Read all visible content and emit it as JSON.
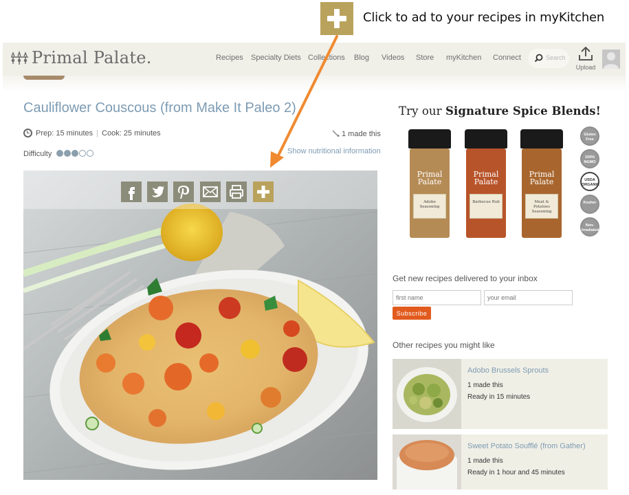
{
  "callout": {
    "text": "Click to ad to your recipes in myKitchen",
    "icon": "plus-icon",
    "color": "#b9a25b"
  },
  "navbar": {
    "logo": "Primal Palate.",
    "items": [
      "Recipes",
      "Specialty Diets",
      "Collections",
      "Blog",
      "Videos",
      "Store",
      "myKitchen",
      "Connect"
    ],
    "search_placeholder": "Search",
    "upload_label": "Upload"
  },
  "recipe": {
    "title": "Cauliflower Couscous (from Make It Paleo 2)",
    "prep": "Prep: 15 minutes",
    "cook": "Cook: 25 minutes",
    "made_this": "1 made this",
    "difficulty_label": "Difficulty",
    "difficulty_level": 3,
    "difficulty_max": 5,
    "nutrition_link": "Show nutritional information",
    "share_buttons": [
      "facebook-icon",
      "twitter-icon",
      "pinterest-icon",
      "email-icon",
      "print-icon",
      "plus-icon"
    ]
  },
  "sidebar": {
    "spice_title_pre": "Try our",
    "spice_title_bold": "Signature Spice Blends!",
    "jar_brand": "Primal Palate",
    "jars": [
      {
        "name": "Adobo Seasoning",
        "color": "#b58b55"
      },
      {
        "name": "Barbecue Rub",
        "color": "#b8542a"
      },
      {
        "name": "Meat & Potatoes Seasoning",
        "color": "#a8662e"
      }
    ],
    "badges": [
      "Gluten Free",
      "100% NGMO",
      "USDA ORGANIC",
      "Kosher",
      "Non-Irradiated"
    ],
    "newsletter": {
      "heading": "Get new recipes delivered to your inbox",
      "first_name_placeholder": "first name",
      "email_placeholder": "your email",
      "button": "Subscribe"
    },
    "other_heading": "Other recipes you might like",
    "other_recipes": [
      {
        "title": "Adobo Brussels Sprouts",
        "made": "1 made this",
        "ready": "Ready in 15 minutes"
      },
      {
        "title": "Sweet Potato Soufflé (from Gather)",
        "made": "1 made this",
        "ready": "Ready in 1 hour and 45 minutes"
      }
    ]
  }
}
